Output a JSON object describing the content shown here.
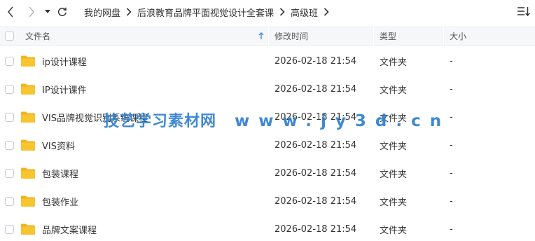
{
  "breadcrumb": [
    {
      "label": "我的网盘"
    },
    {
      "label": "后浪教育品牌平面视觉设计全套课"
    },
    {
      "label": "高级班"
    }
  ],
  "header": {
    "name": "文件名",
    "modified": "修改时间",
    "type": "类型",
    "size": "大小"
  },
  "files": [
    {
      "name": "ip设计课程",
      "modified": "2026-02-18 21:54",
      "type": "文件夹",
      "size": "-"
    },
    {
      "name": "IP设计课件",
      "modified": "2026-02-18 21:54",
      "type": "文件夹",
      "size": "-"
    },
    {
      "name": "VIS品牌视觉识别系统课程",
      "modified": "2026-02-18 21:54",
      "type": "文件夹",
      "size": "-"
    },
    {
      "name": "VIS资料",
      "modified": "2026-02-18 21:54",
      "type": "文件夹",
      "size": "-"
    },
    {
      "name": "包装课程",
      "modified": "2026-02-18 21:54",
      "type": "文件夹",
      "size": "-"
    },
    {
      "name": "包装作业",
      "modified": "2026-02-18 21:54",
      "type": "文件夹",
      "size": "-"
    },
    {
      "name": "品牌文案课程",
      "modified": "2026-02-18 21:54",
      "type": "文件夹",
      "size": "-"
    }
  ],
  "watermark": {
    "text": "技艺学习素材网",
    "url": "www.jy3d.cn"
  },
  "colors": {
    "folder": "#f7c531",
    "folder_tab": "#f0b41a",
    "header_bg": "#f6f7f9",
    "sort_arrow": "#4a90e2",
    "watermark": "#2f7fd1"
  },
  "icons": {
    "back": "chevron-left-icon",
    "forward": "chevron-right-icon",
    "dropdown": "caret-down-icon",
    "refresh": "refresh-icon",
    "crumb_separator": "chevron-right-icon",
    "sort_menu": "sort-list-icon",
    "sort_indicator": "arrow-up-icon",
    "folder": "folder-icon"
  }
}
